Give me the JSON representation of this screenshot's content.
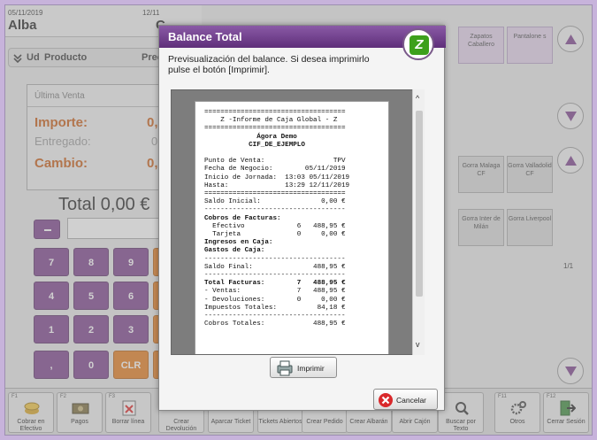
{
  "header": {
    "date": "05/11/2019",
    "user": "Alba",
    "date2": "12/11",
    "c": "C"
  },
  "lines_header": {
    "ud": "Ud",
    "product": "Producto",
    "price": "Preci"
  },
  "summary": {
    "last_sale": "Última Venta",
    "importe_label": "Importe:",
    "importe_value": "0,0",
    "entregado_label": "Entregado:",
    "entregado_value": "0,",
    "cambio_label": "Cambio:",
    "cambio_value": "0,0"
  },
  "total": "Total 0,00 €",
  "keypad": [
    "7",
    "8",
    "9",
    "4",
    "5",
    "6",
    "1",
    "2",
    "3",
    ",",
    "0",
    "CLR"
  ],
  "products_top": [
    {
      "label": "Zapatos Caballero",
      "highlight": true
    },
    {
      "label": "Pantalone s",
      "highlight": true
    }
  ],
  "products_mid": [
    "Gorra Malaga CF",
    "Gorra Valladolid CF",
    "Gorra Inter de Milán",
    "Gorra Liverpool"
  ],
  "pager": "1/1",
  "fkeys": [
    {
      "fn": "F1",
      "label": "Cobrar en Efectivo"
    },
    {
      "fn": "F2",
      "label": "Pagos"
    },
    {
      "fn": "F3",
      "label": "Borrar línea"
    },
    {
      "fn": "",
      "label": "Crear Devolución"
    },
    {
      "fn": "",
      "label": "Aparcar Ticket"
    },
    {
      "fn": "",
      "label": "Tickets Abiertos"
    },
    {
      "fn": "",
      "label": "Crear Pedido"
    },
    {
      "fn": "",
      "label": "Crear Albarán"
    },
    {
      "fn": "",
      "label": "Abrir Cajón"
    },
    {
      "fn": "",
      "label": "Buscar por Texto"
    },
    {
      "fn": "F11",
      "label": "Otros"
    },
    {
      "fn": "F12",
      "label": "Cerrar Sesión"
    }
  ],
  "dialog": {
    "title": "Balance Total",
    "message": "Previsualización del balance. Si desea imprimirlo pulse el botón [Imprimir].",
    "print_label": "Imprimir",
    "cancel_label": "Cancelar",
    "report": [
      "===================================",
      "    Z -Informe de Caja Global - Z",
      "===================================",
      "             Ágora Demo",
      "           CIF_DE_EJEMPLO",
      "",
      "Punto de Venta:                 TPV",
      "Fecha de Negocio:        05/11/2019",
      "Inicio de Jornada:  13:03 05/11/2019",
      "Hasta:              13:29 12/11/2019",
      "===================================",
      "Saldo Inicial:               0,00 €",
      "-----------------------------------",
      "Cobros de Facturas:",
      "  Efectivo             6   488,95 €",
      "  Tarjeta              0     0,00 €",
      "Ingresos en Caja:",
      "Gastos de Caja:",
      "-----------------------------------",
      "Saldo Final:               488,95 €",
      "-----------------------------------",
      "Total Facturas:        7   488,95 €",
      "- Ventas:              7   488,95 €",
      "- Devoluciones:        0     0,00 €",
      "Impuestos Totales:          84,18 €",
      "-----------------------------------",
      "Cobros Totales:            488,95 €"
    ]
  }
}
